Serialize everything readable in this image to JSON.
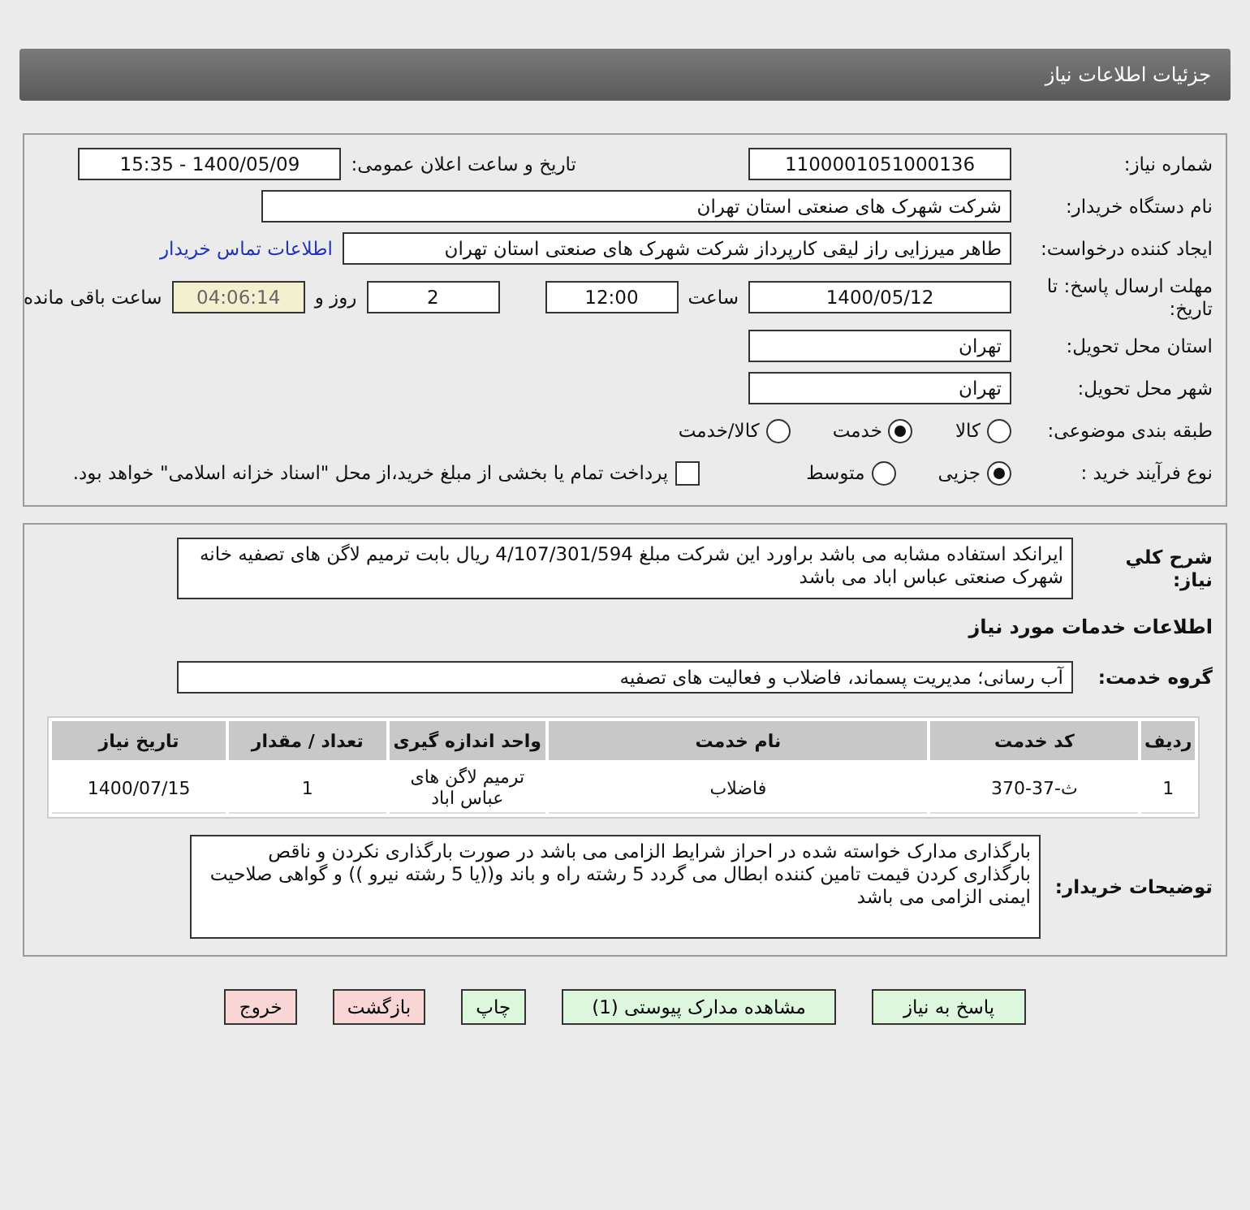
{
  "header": {
    "title": "جزئیات اطلاعات نیاز"
  },
  "need_number": {
    "label": "شماره نیاز:",
    "value": "1100001051000136"
  },
  "announce": {
    "label": "تاریخ و ساعت اعلان عمومی:",
    "value": "1400/05/09 - 15:35"
  },
  "buyer": {
    "label": "نام دستگاه خریدار:",
    "value": "شرکت شهرک های صنعتی استان تهران"
  },
  "creator": {
    "label": "ایجاد کننده درخواست:",
    "value": "طاهر  میرزایی راز لیقی کارپرداز شرکت شهرک های صنعتی استان تهران",
    "link": "اطلاعات تماس خریدار"
  },
  "deadline": {
    "label": "مهلت ارسال پاسخ: تا تاریخ:",
    "date": "1400/05/12",
    "time_label": "ساعت",
    "time": "12:00",
    "days": "2",
    "days_label": "روز و",
    "remaining": "04:06:14",
    "remaining_label": "ساعت باقی مانده"
  },
  "province": {
    "label": "استان محل تحویل:",
    "value": "تهران"
  },
  "city": {
    "label": "شهر محل تحویل:",
    "value": "تهران"
  },
  "category": {
    "label": "طبقه بندی موضوعی:",
    "options": [
      {
        "label": "کالا",
        "selected": false
      },
      {
        "label": "خدمت",
        "selected": true
      },
      {
        "label": "کالا/خدمت",
        "selected": false
      }
    ]
  },
  "process": {
    "label": "نوع فرآیند خرید :",
    "options": [
      {
        "label": "جزیی",
        "selected": true
      },
      {
        "label": "متوسط",
        "selected": false
      }
    ],
    "treasury": {
      "label": "پرداخت تمام یا بخشی از مبلغ خرید،از محل \"اسناد خزانه اسلامی\" خواهد بود.",
      "checked": false
    }
  },
  "description": {
    "label": "شرح کلي نياز:",
    "text": "ایرانکد استفاده مشابه می باشد براورد این شرکت مبلغ 4/107/301/594 ریال بابت ترمیم لاگن های تصفیه خانه شهرک صنعتی عباس اباد می باشد"
  },
  "services_title": "اطلاعات خدمات مورد نیاز",
  "service_group": {
    "label": "گروه خدمت:",
    "value": "آب رسانی؛ مدیریت پسماند، فاضلاب و فعالیت های تصفیه"
  },
  "table": {
    "columns": [
      "ردیف",
      "کد خدمت",
      "نام خدمت",
      "واحد اندازه گیری",
      "تعداد / مقدار",
      "تاریخ نیاز"
    ],
    "rows": [
      [
        "1",
        "ث-37-370",
        "فاضلاب",
        "ترمیم لاگن های عباس اباد",
        "1",
        "1400/07/15"
      ]
    ]
  },
  "buyer_notes": {
    "label": "توضیحات خریدار:",
    "text": "بارگذاری مدارک خواسته شده در احراز شرایط الزامی می باشد در صورت بارگذاری نکردن و ناقص بارگذاری کردن قیمت تامین کننده ابطال می گردد 5 رشته راه و باند و((یا 5 رشته نیرو )) و گواهی صلاحیت ایمنی الزامی می باشد"
  },
  "buttons": [
    {
      "label": "پاسخ به نیاز",
      "kind": "normal"
    },
    {
      "label": "مشاهده مدارک پیوستی (1)",
      "kind": "normal"
    },
    {
      "label": "چاپ",
      "kind": "normal"
    },
    {
      "label": "بازگشت",
      "kind": "danger"
    },
    {
      "label": "خروج",
      "kind": "danger"
    }
  ]
}
